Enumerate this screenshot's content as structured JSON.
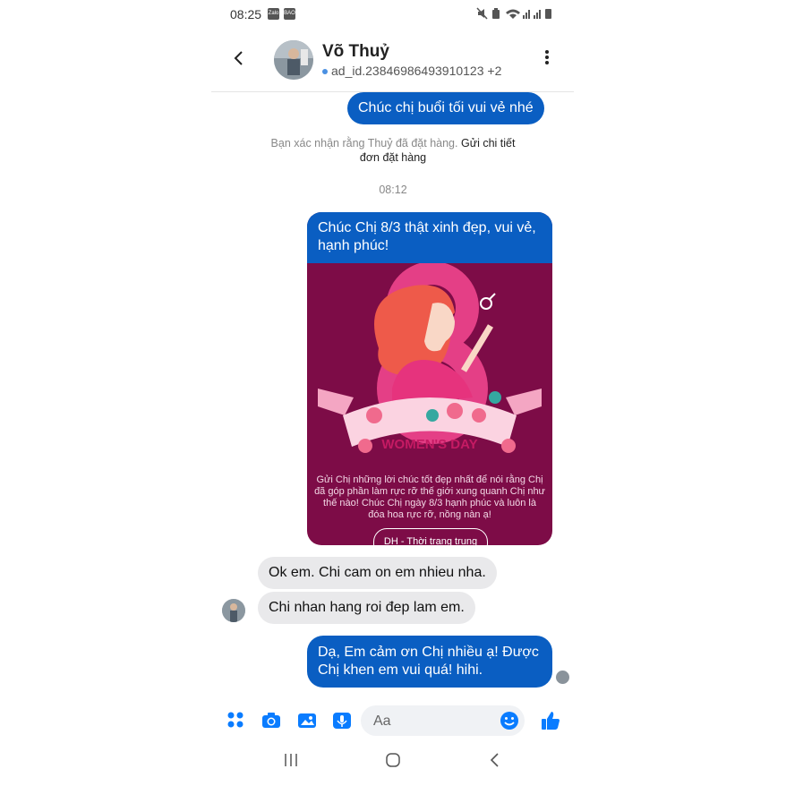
{
  "status_bar": {
    "time": "08:25",
    "app_icons": [
      "Zalo",
      "BAO MOI"
    ],
    "right_icons": [
      "mute-icon",
      "data-saver-icon",
      "wifi-icon",
      "signal-icon",
      "signal-icon",
      "battery-icon"
    ]
  },
  "header": {
    "name": "Võ Thuỷ",
    "subtitle": "ad_id.23846986493910123 +2",
    "back_icon": "chevron-left-icon",
    "more_icon": "more-vertical-icon"
  },
  "messages": {
    "out1": "Chúc chị buổi tối vui vẻ nhé",
    "system_note": "Bạn xác nhận rằng Thuỷ đã đặt hàng.",
    "system_link": "Gửi chi tiết đơn đặt hàng",
    "timestamp": "08:12",
    "card": {
      "text": "Chúc Chị 8/3 thật xinh đẹp, vui vẻ, hạnh phúc!",
      "banner": "WOMEN'S DAY",
      "caption": "Gửi Chị những lời chúc tốt đẹp nhất để nói rằng Chị đã góp phần làm rực rỡ thế giới xung quanh Chị như thế nào! Chúc Chị ngày 8/3 hạnh phúc và luôn là đóa hoa rực rỡ, nồng nàn ạ!",
      "button": "DH - Thời trang trung niên"
    },
    "in1": "Ok em. Chi cam on em nhieu nha.",
    "in2": "Chi nhan hang roi đep lam em.",
    "out2": "Dạ, Em cảm ơn Chị nhiều ạ! Được Chị khen em vui quá! hihi."
  },
  "composer": {
    "placeholder": "Aa",
    "icons": [
      "grid-menu-icon",
      "camera-icon",
      "image-icon",
      "voice-icon",
      "emoji-icon",
      "like-icon"
    ]
  },
  "navbar": {
    "icons": [
      "recents-icon",
      "home-icon",
      "back-icon"
    ]
  },
  "colors": {
    "accent": "#0a5ec2",
    "card_bg": "#7d0c47",
    "incoming_bubble": "#e9e9eb"
  }
}
